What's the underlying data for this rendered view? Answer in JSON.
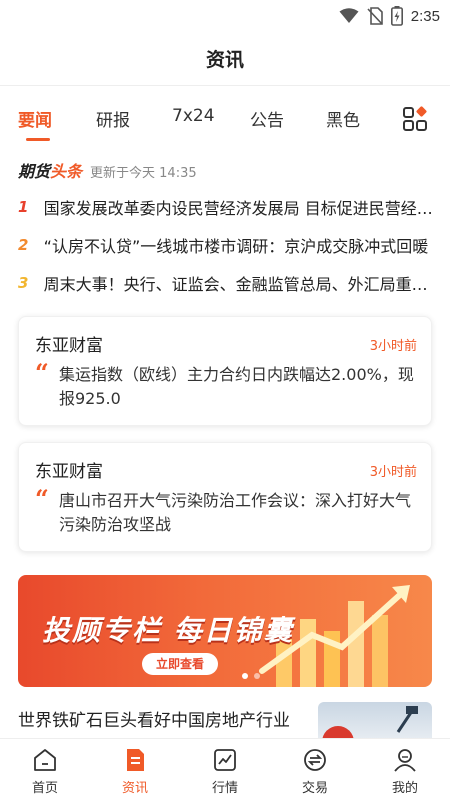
{
  "status_bar": {
    "time": "2:35"
  },
  "header": {
    "title": "资讯"
  },
  "tabs": [
    {
      "label": "要闻",
      "active": true
    },
    {
      "label": "研报",
      "active": false
    },
    {
      "label": "7x24",
      "active": false
    },
    {
      "label": "公告",
      "active": false
    },
    {
      "label": "黑色",
      "active": false
    }
  ],
  "headline": {
    "brand_part1": "期货",
    "brand_part2": "头条",
    "updated": "更新于今天 14:35",
    "items": [
      {
        "rank": "1",
        "text": "国家发展改革委内设民营经济发展局 目标促进民营经济发展壮大",
        "rank_color": "#e8402c"
      },
      {
        "rank": "2",
        "text": "“认房不认贷”一线城市楼市调研：京沪成交脉冲式回暖",
        "rank_color": "#f28a2e"
      },
      {
        "rank": "3",
        "text": "周末大事！央行、证监会、金融监管总局、外汇局重磅发声",
        "rank_color": "#f2b630"
      }
    ]
  },
  "cards": [
    {
      "source": "东亚财富",
      "time": "3小时前",
      "quote_mark": "“",
      "text": "集运指数（欧线）主力合约日内跌幅达2.00%，现报925.0"
    },
    {
      "source": "东亚财富",
      "time": "3小时前",
      "quote_mark": "“",
      "text": "唐山市召开大气污染防治工作会议：深入打好大气污染防治攻坚战"
    }
  ],
  "banner": {
    "title": "投顾专栏  每日锦囊",
    "button": "立即查看"
  },
  "article": {
    "title": "世界铁矿石巨头看好中国房地产行业"
  },
  "bottom_nav": [
    {
      "label": "首页",
      "icon": "home-icon",
      "active": false
    },
    {
      "label": "资讯",
      "icon": "news-icon",
      "active": true
    },
    {
      "label": "行情",
      "icon": "market-chart-icon",
      "active": false
    },
    {
      "label": "交易",
      "icon": "trade-exchange-icon",
      "active": false
    },
    {
      "label": "我的",
      "icon": "profile-icon",
      "active": false
    }
  ],
  "colors": {
    "accent": "#f05a28",
    "text": "#222222",
    "muted": "#888888"
  }
}
